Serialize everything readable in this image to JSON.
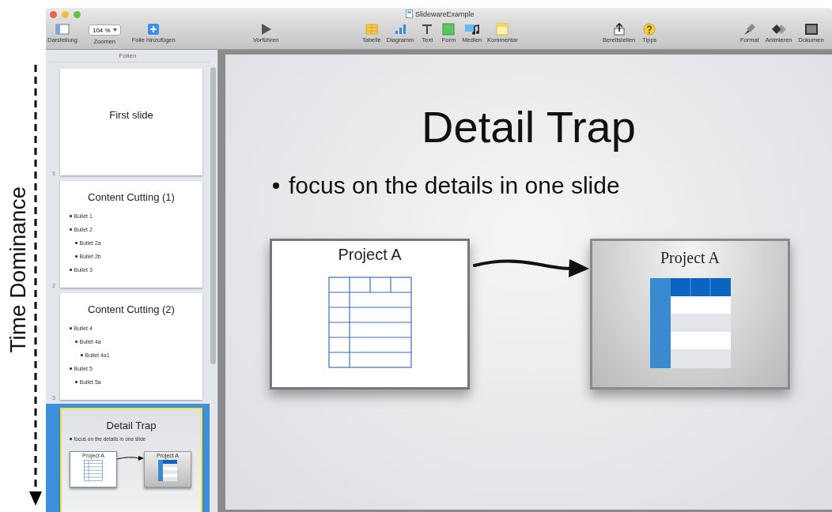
{
  "annotation": {
    "label": "Time Dominance"
  },
  "window": {
    "title": "SlidewareExample"
  },
  "toolbar": [
    [
      {
        "kind": "view",
        "label": "Darstellung"
      },
      {
        "kind": "zoom",
        "label": "Zoomen",
        "value": "104 %"
      },
      {
        "kind": "add",
        "label": "Folie hinzufügen"
      }
    ],
    [
      {
        "kind": "play",
        "label": "Vorführen"
      }
    ],
    [
      {
        "kind": "table",
        "label": "Tabelle"
      },
      {
        "kind": "chart",
        "label": "Diagramm"
      },
      {
        "kind": "text",
        "label": "Text"
      },
      {
        "kind": "shape",
        "label": "Form"
      },
      {
        "kind": "media",
        "label": "Medien"
      },
      {
        "kind": "comment",
        "label": "Kommentar"
      }
    ],
    [
      {
        "kind": "share",
        "label": "Bereitstellen"
      },
      {
        "kind": "tips",
        "label": "Tipps"
      }
    ],
    [
      {
        "kind": "format",
        "label": "Format"
      },
      {
        "kind": "animate",
        "label": "Animieren"
      },
      {
        "kind": "document",
        "label": "Dokumen"
      }
    ]
  ],
  "sidebar": {
    "header": "Folien",
    "slides": [
      {
        "number": "1",
        "kind": "title",
        "selected": false,
        "title": "First slide"
      },
      {
        "number": "2",
        "kind": "bullets",
        "selected": false,
        "title": "Content Cutting (1)",
        "bullets": [
          {
            "text": "Bullet 1"
          },
          {
            "text": "Bullet 2",
            "children": [
              {
                "text": "Bullet 2a"
              },
              {
                "text": "Bullet 2b"
              }
            ]
          },
          {
            "text": "Bullet 3"
          }
        ]
      },
      {
        "number": "3",
        "kind": "bullets",
        "selected": false,
        "title": "Content Cutting (2)",
        "bullets": [
          {
            "text": "Bullet 4",
            "children": [
              {
                "text": "Bullet 4a",
                "children": [
                  {
                    "text": "Bullet 4a1"
                  }
                ]
              }
            ]
          },
          {
            "text": "Bullet 5",
            "children": [
              {
                "text": "Bullet 5a"
              }
            ]
          }
        ]
      },
      {
        "kind": "diagram",
        "selected": true,
        "title": "Detail Trap",
        "bullets": [
          {
            "text": "focus on the details in one slide"
          }
        ],
        "boxes": [
          {
            "kind": "sketch",
            "title": "Project A"
          },
          {
            "kind": "styled",
            "title": "Project A"
          }
        ]
      }
    ]
  },
  "slide": {
    "title": "Detail Trap",
    "bullets": [
      {
        "text": "focus on the details in one slide"
      }
    ],
    "boxes": [
      {
        "kind": "sketch",
        "title": "Project A"
      },
      {
        "kind": "styled",
        "title": "Project A"
      }
    ]
  }
}
